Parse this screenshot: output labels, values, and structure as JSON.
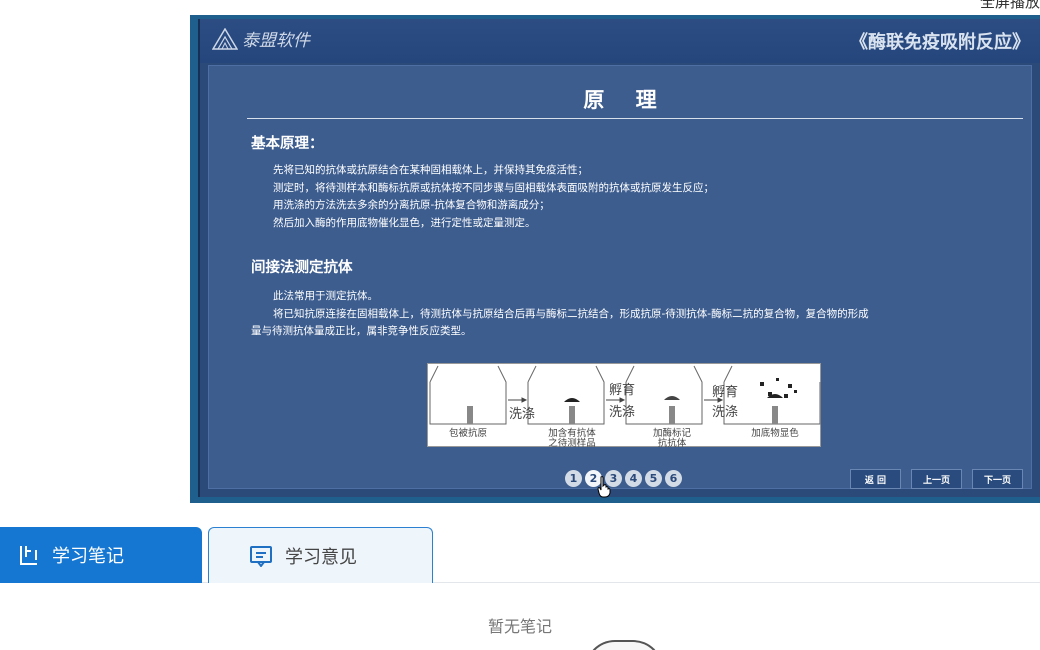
{
  "corner_link": "全屏播放",
  "player": {
    "brand": "泰盟软件",
    "course_title": "《酶联免疫吸附反应》",
    "slide": {
      "title": "原 理",
      "section1": {
        "heading": "基本原理：",
        "lines": [
          "先将已知的抗体或抗原结合在某种固相载体上，并保持其免疫活性；",
          "测定时，将待测样本和酶标抗原或抗体按不同步骤与固相载体表面吸附的抗体或抗原发生反应；",
          "用洗涤的方法洗去多余的分离抗原-抗体复合物和游离成分；",
          "然后加入酶的作用底物催化显色，进行定性或定量测定。"
        ]
      },
      "section2": {
        "heading": "间接法测定抗体",
        "line1": "此法常用于测定抗体。",
        "line2": "将已知抗原连接在固相载体上，待测抗体与抗原结合后再与酶标二抗结合，形成抗原-待测抗体-酶标二抗的复合物，复合物的形成",
        "line3": "量与待测抗体量成正比，属非竞争性反应类型。"
      },
      "diagram": {
        "step_labels": [
          "包被抗原",
          "加含有抗体\n之待测样品",
          "加酶标记\n抗抗体",
          "加底物显色"
        ],
        "wash1": "洗涤",
        "incubate1": "孵育",
        "wash2": "洗涤",
        "incubate2": "孵育",
        "wash3": "洗涤"
      }
    },
    "pager": [
      "1",
      "2",
      "3",
      "4",
      "5",
      "6"
    ],
    "active_page": 2,
    "nav": {
      "back": "返 回",
      "prev": "上一页",
      "next": "下一页"
    }
  },
  "tabs": {
    "notes": {
      "label": "学习笔记",
      "icon": "note-icon"
    },
    "feedback": {
      "label": "学习意见",
      "icon": "message-icon"
    }
  },
  "empty_state": "暂无笔记",
  "colors": {
    "accent": "#1677d2",
    "player_bg": "#2b4a7a"
  }
}
